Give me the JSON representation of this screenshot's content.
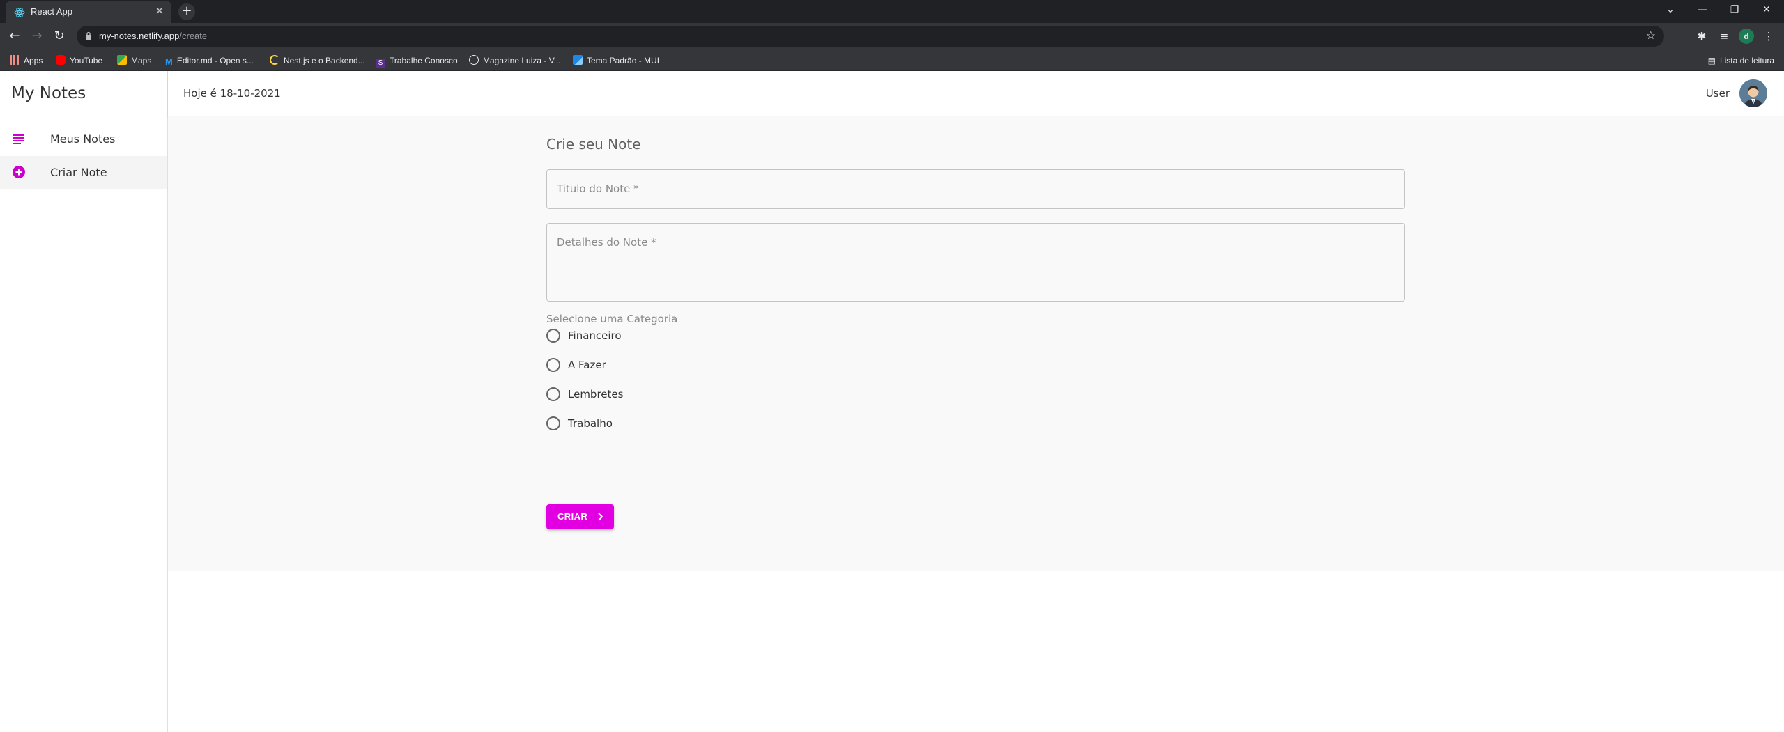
{
  "browser": {
    "tab_title": "React App",
    "url_host": "my-notes.netlify.app",
    "url_path": "/create",
    "bookmarks": [
      {
        "label": "Apps",
        "icon": "apps-grid-icon",
        "color": "#f28b82"
      },
      {
        "label": "YouTube",
        "icon": "youtube-icon",
        "color": "#ff0000"
      },
      {
        "label": "Maps",
        "icon": "maps-icon",
        "color": "#34a853"
      },
      {
        "label": "Editor.md - Open s...",
        "icon": "editormd-icon",
        "color": "#2196f3"
      },
      {
        "label": "Nest.js e o Backend...",
        "icon": "codeacademy-icon",
        "color": "#ffd740"
      },
      {
        "label": "Trabalhe Conosco",
        "icon": "s-logo-icon",
        "color": "#5c2d91"
      },
      {
        "label": "Magazine Luiza - V...",
        "icon": "globe-icon",
        "color": "#e8eaed"
      },
      {
        "label": "Tema Padrão - MUI",
        "icon": "mui-icon",
        "color": "#1e88e5"
      }
    ],
    "reading_list": "Lista de leitura",
    "profile_initial": "d"
  },
  "app": {
    "brand": "My Notes",
    "nav": [
      {
        "label": "Meus Notes",
        "icon": "notes-list-icon"
      },
      {
        "label": "Criar Note",
        "icon": "add-circle-icon"
      }
    ],
    "accent": "#e200e2",
    "appbar": {
      "date": "Hoje é 18-10-2021",
      "user": "User"
    }
  },
  "form": {
    "title": "Crie seu Note",
    "title_placeholder": "Titulo do Note *",
    "details_placeholder": "Detalhes do Note *",
    "category_label": "Selecione uma Categoria",
    "categories": [
      "Financeiro",
      "A Fazer",
      "Lembretes",
      "Trabalho"
    ],
    "submit": "CRIAR"
  }
}
